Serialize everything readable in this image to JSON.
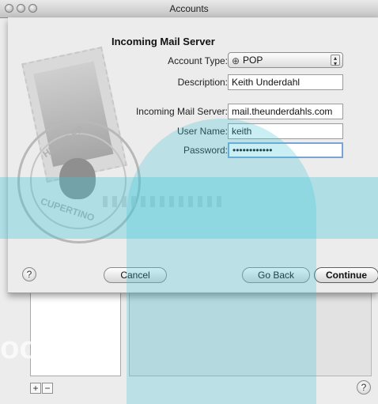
{
  "window": {
    "title": "Accounts"
  },
  "sheet": {
    "heading": "Incoming Mail Server",
    "account_type": {
      "label": "Account Type:",
      "value": "POP",
      "icon": "pop-globe-icon"
    },
    "description": {
      "label": "Description:",
      "value": "Keith Underdahl"
    },
    "incoming_server": {
      "label": "Incoming Mail Server:",
      "value": "mail.theunderdahls.com"
    },
    "user_name": {
      "label": "User Name:",
      "value": "keith"
    },
    "password": {
      "label": "Password:",
      "value": "••••••••••••"
    },
    "postmark": {
      "top_text": "HELLO FR",
      "bottom_text": "CUPERTINO"
    },
    "buttons": {
      "help": "?",
      "cancel": "Cancel",
      "go_back": "Go Back",
      "continue": "Continue"
    }
  },
  "accounts_window": {
    "add": "+",
    "remove": "−",
    "help": "?"
  },
  "watermark": {
    "text": "ooks"
  },
  "colors": {
    "watermark": "#3ec6d9",
    "focus_ring": "#7aa3d6"
  }
}
